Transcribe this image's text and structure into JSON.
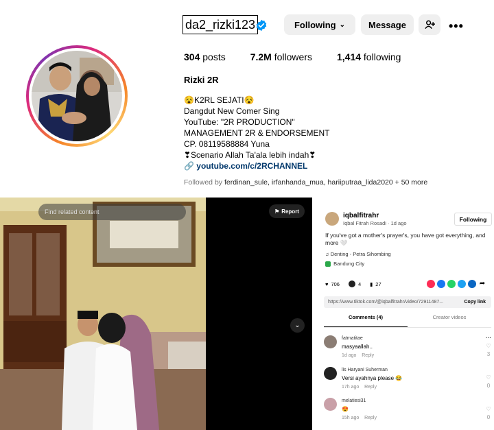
{
  "profile": {
    "username": "da2_rizki123",
    "buttons": {
      "following": "Following",
      "message": "Message"
    },
    "stats": {
      "posts_count": "304",
      "posts_label": "posts",
      "followers_count": "7.2M",
      "followers_label": "followers",
      "following_count": "1,414",
      "following_label": "following"
    },
    "full_name": "Rizki 2R",
    "bio": [
      "😵K2RL SEJATI😵",
      "Dangdut New Comer Sing",
      "YouTube: \"2R PRODUCTION\"",
      "MANAGEMENT 2R & ENDORSEMENT",
      "CP. 08119588884 Yuna",
      "❣Scenario Allah Ta'ala lebih indah❣"
    ],
    "link": "youtube.com/c/2RCHANNEL",
    "followed_by": {
      "prefix": "Followed by",
      "names": "ferdinan_sule, irfanhanda_mua, hariiputraa_lida2020",
      "more": "+ 50 more"
    }
  },
  "video": {
    "search_placeholder": "Find related content",
    "report_label": "Report"
  },
  "tiktok": {
    "author": "iqbalfitrahr",
    "author_sub": "Iqbal Fitrah Rosadi · 1d ago",
    "follow_label": "Following",
    "caption": "If you've got a mother's prayer's, you have got everything, and more 🤍",
    "music": "Denting - Petra Sihombing",
    "location": "Bandung City",
    "likes": "706",
    "comments_count": "4",
    "saves": "27",
    "url": "https://www.tiktok.com/@iqbalfitrahr/video/72911487...",
    "copy_label": "Copy link",
    "tab_comments": "Comments (4)",
    "tab_creator": "Creator videos",
    "comments": [
      {
        "user": "fatmatitae",
        "text": "masyaallah..",
        "time": "1d ago",
        "reply": "Reply",
        "likes": "3"
      },
      {
        "user": "lis Haryani Suherman",
        "text": "Versi ayahnya please 😂",
        "time": "17h ago",
        "reply": "Reply",
        "likes": "0"
      },
      {
        "user": "melatiesi31",
        "text": "😍",
        "time": "15h ago",
        "reply": "Reply",
        "likes": "0"
      }
    ]
  },
  "colors": {
    "verified": "#0095f6",
    "link": "#00376b",
    "button_bg": "#efefef"
  }
}
